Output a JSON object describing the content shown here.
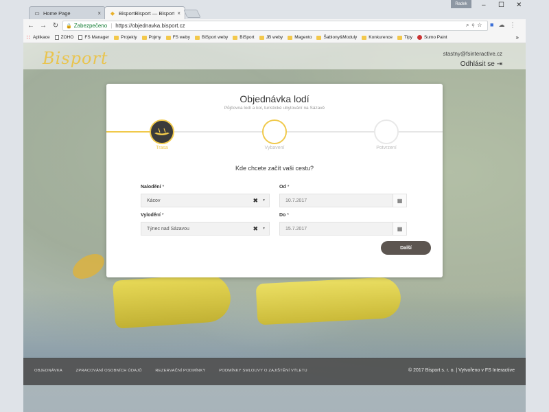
{
  "browser": {
    "tabs": [
      {
        "label": "Home Page",
        "active": false
      },
      {
        "label": "BisportBisport — Bisport",
        "active": true
      }
    ],
    "user_chip": "Radek",
    "address": {
      "secure_label": "Zabezpečeno",
      "url": "https://objednavka.bisport.cz"
    },
    "bookmarks": [
      "Aplikace",
      "ZOHO",
      "FS Manager",
      "Projekty",
      "Pojmy",
      "FS weby",
      "BiSport weby",
      "BiSport",
      "JB weby",
      "Magento",
      "Šablony&Moduly",
      "Konkurence",
      "Tipy",
      "Sumo Paint"
    ],
    "bookmarks_more": "»"
  },
  "header": {
    "logo": "Bisport",
    "email": "stastny@fsinteractive.cz",
    "logout": "Odhlásit se"
  },
  "card": {
    "title": "Objednávka lodí",
    "subtitle": "Půjčovna lodí a kol, turistické ubytování na Sázavě",
    "steps": [
      "Trasa",
      "Vybavení",
      "Potvrzení"
    ],
    "question": "Kde chcete začít vaši cestu?",
    "fields": {
      "nalodeni_label": "Nalodění",
      "nalodeni_value": "Kácov",
      "od_label": "Od",
      "od_value": "10.7.2017",
      "vylodeni_label": "Vylodění",
      "vylodeni_value": "Týnec nad Sázavou",
      "do_label": "Do",
      "do_value": "15.7.2017",
      "required_mark": "*"
    },
    "next_label": "Další"
  },
  "footer": {
    "links": [
      "OBJEDNÁVKA",
      "ZPRACOVÁNÍ OSOBNÍCH ÚDAJŮ",
      "REZERVAČNÍ PODMÍNKY",
      "PODMÍNKY SMLOUVY O ZAJIŠTĚNÍ VÝLETU"
    ],
    "copyright": "© 2017 Bisport s. r. o. | Vytvořeno v FS Interactive"
  }
}
